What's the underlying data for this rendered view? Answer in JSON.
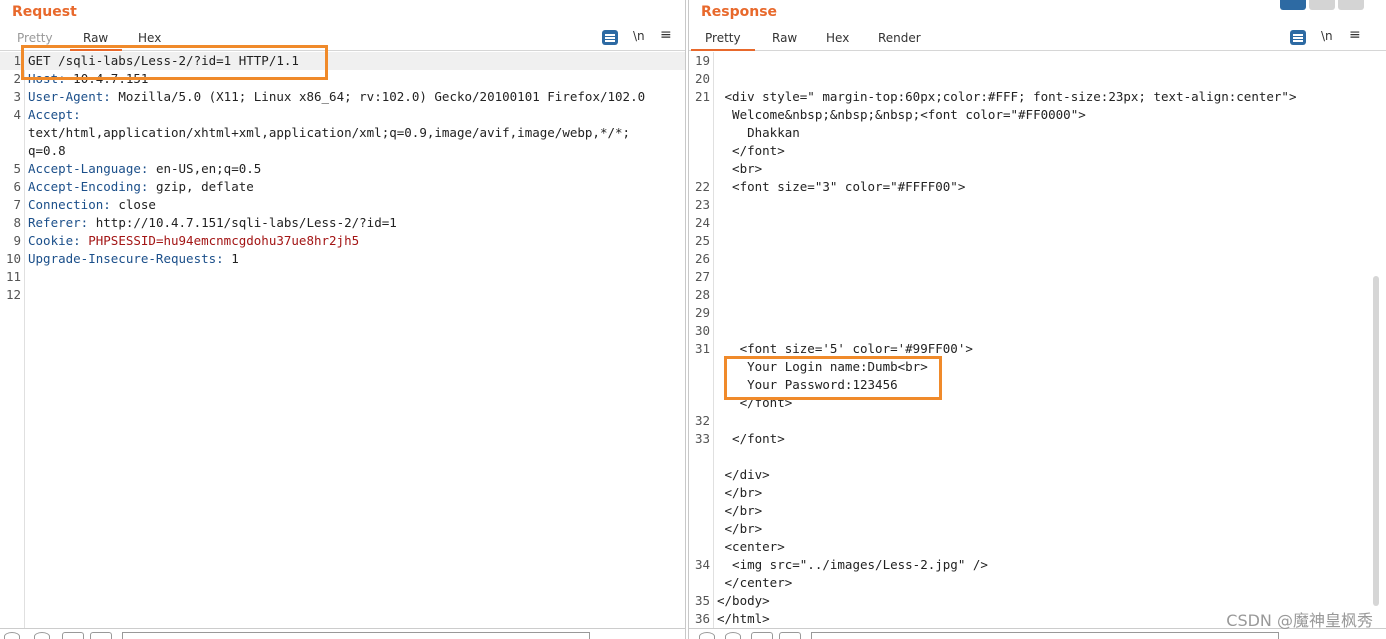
{
  "request": {
    "title": "Request",
    "tabs": [
      "Pretty",
      "Raw",
      "Hex"
    ],
    "active_tab": "Raw",
    "newline_label": "\\n",
    "menu_icon": "≡",
    "lines": [
      {
        "n": "1",
        "t": "GET /sqli-labs/Less-2/?id=1 HTTP/1.1"
      },
      {
        "n": "2",
        "t": "Host: 10.4.7.151"
      },
      {
        "n": "3",
        "t": "User-Agent: Mozilla/5.0 (X11; Linux x86_64; rv:102.0) Gecko/20100101 Firefox/102.0"
      },
      {
        "n": "4",
        "t": "Accept:"
      },
      {
        "n": "",
        "t": "text/html,application/xhtml+xml,application/xml;q=0.9,image/avif,image/webp,*/*;"
      },
      {
        "n": "",
        "t": "q=0.8"
      },
      {
        "n": "5",
        "t": "Accept-Language: en-US,en;q=0.5"
      },
      {
        "n": "6",
        "t": "Accept-Encoding: gzip, deflate"
      },
      {
        "n": "7",
        "t": "Connection: close"
      },
      {
        "n": "8",
        "t": "Referer: http://10.4.7.151/sqli-labs/Less-2/?id=1"
      },
      {
        "n": "9",
        "t": "Cookie: PHPSESSID=hu94emcnmcgdohu37ue8hr2jh5"
      },
      {
        "n": "10",
        "t": "Upgrade-Insecure-Requests: 1"
      },
      {
        "n": "11",
        "t": ""
      },
      {
        "n": "12",
        "t": ""
      }
    ]
  },
  "response": {
    "title": "Response",
    "tabs": [
      "Pretty",
      "Raw",
      "Hex",
      "Render"
    ],
    "active_tab": "Pretty",
    "newline_label": "\\n",
    "menu_icon": "≡",
    "lines": [
      {
        "n": "19",
        "t": ""
      },
      {
        "n": "20",
        "t": ""
      },
      {
        "n": "21",
        "t": " <div style=\" margin-top:60px;color:#FFF; font-size:23px; text-align:center\">"
      },
      {
        "n": "",
        "t": "  Welcome&nbsp;&nbsp;&nbsp;<font color=\"#FF0000\">"
      },
      {
        "n": "",
        "t": "    Dhakkan"
      },
      {
        "n": "",
        "t": "  </font>"
      },
      {
        "n": "",
        "t": "  <br>"
      },
      {
        "n": "22",
        "t": "  <font size=\"3\" color=\"#FFFF00\">"
      },
      {
        "n": "23",
        "t": ""
      },
      {
        "n": "24",
        "t": ""
      },
      {
        "n": "25",
        "t": ""
      },
      {
        "n": "26",
        "t": ""
      },
      {
        "n": "27",
        "t": ""
      },
      {
        "n": "28",
        "t": ""
      },
      {
        "n": "29",
        "t": ""
      },
      {
        "n": "30",
        "t": ""
      },
      {
        "n": "31",
        "t": "   <font size='5' color='#99FF00'>"
      },
      {
        "n": "",
        "t": "    Your Login name:Dumb<br>"
      },
      {
        "n": "",
        "t": "    Your Password:123456"
      },
      {
        "n": "",
        "t": "   </font>"
      },
      {
        "n": "32",
        "t": ""
      },
      {
        "n": "33",
        "t": "  </font>"
      },
      {
        "n": "",
        "t": ""
      },
      {
        "n": "",
        "t": " </div>"
      },
      {
        "n": "",
        "t": " </br>"
      },
      {
        "n": "",
        "t": " </br>"
      },
      {
        "n": "",
        "t": " </br>"
      },
      {
        "n": "",
        "t": " <center>"
      },
      {
        "n": "34",
        "t": "  <img src=\"../images/Less-2.jpg\" />"
      },
      {
        "n": "",
        "t": " </center>"
      },
      {
        "n": "35",
        "t": "</body>"
      },
      {
        "n": "36",
        "t": "</html>"
      }
    ]
  },
  "watermark": "CSDN @魔神皇枫秀",
  "colors": {
    "accent": "#e8692c",
    "highlight_box": "#f08a2a",
    "wrap_button": "#2d6aa3"
  },
  "icons": {
    "wrap": "word-wrap-icon",
    "newline": "newline-icon",
    "menu": "menu-icon",
    "layout": "layout-toggle-icon"
  }
}
